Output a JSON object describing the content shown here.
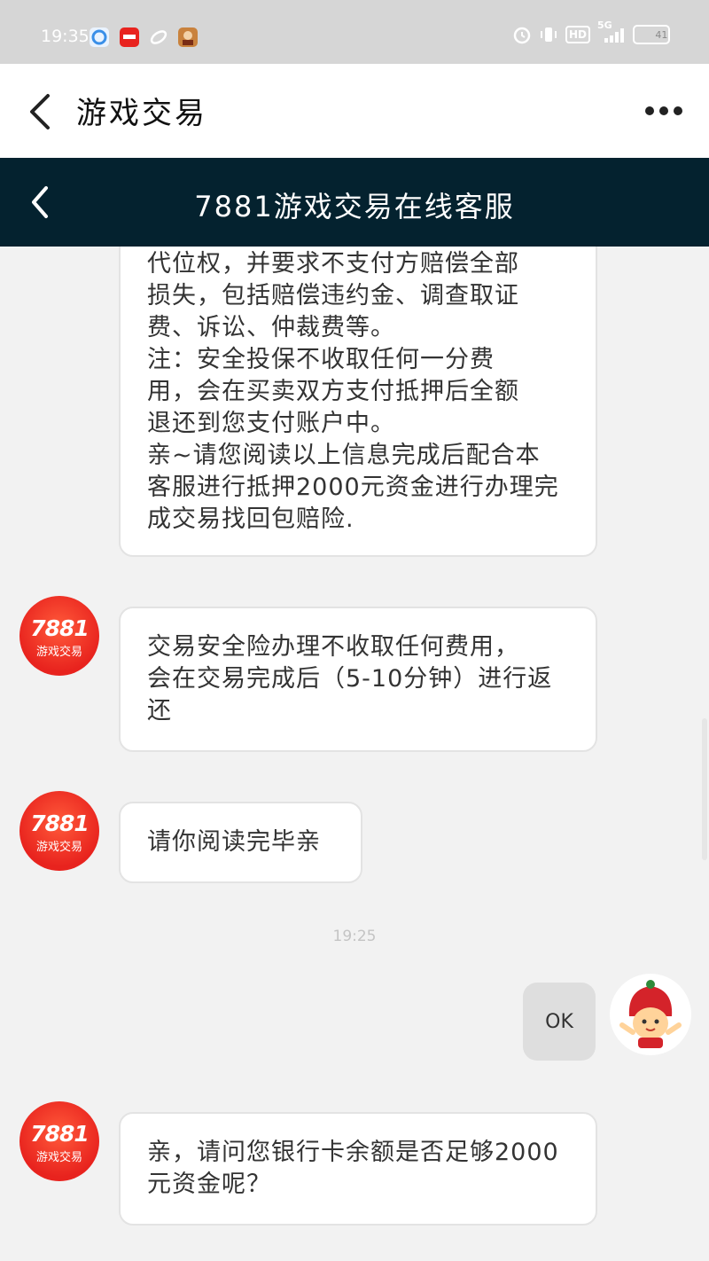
{
  "status_bar": {
    "time": "19:35",
    "hd_label": "HD",
    "network_label": "5G",
    "battery_level": "41",
    "icons": [
      "browser-app-icon",
      "7881-app-icon",
      "link-app-icon",
      "game-app-icon",
      "alarm-icon",
      "vibrate-icon",
      "signal-icon",
      "battery-icon"
    ]
  },
  "app_bar": {
    "title": "游戏交易"
  },
  "chat_header": {
    "title": "7881游戏交易在线客服"
  },
  "avatar": {
    "brand_number": "7881",
    "brand_sub": "游戏交易"
  },
  "messages": [
    {
      "side": "left",
      "text": "代位权，并要求不支付方赔偿全部\n损失，包括赔偿违约金、调查取证\n费、诉讼、仲裁费等。\n注：安全投保不收取任何一分费\n用，会在买卖双方支付抵押后全额\n退还到您支付账户中。\n亲~请您阅读以上信息完成后配合本\n客服进行抵押2000元资金进行办理完\n成交易找回包赔险."
    },
    {
      "side": "left",
      "text": "交易安全险办理不收取任何费用，\n会在交易完成后（5-10分钟）进行返\n还"
    },
    {
      "side": "left",
      "text": "请你阅读完毕亲"
    },
    {
      "side": "right",
      "text": "OK"
    },
    {
      "side": "left",
      "text": "亲，请问您银行卡余额是否足够2000\n元资金呢？"
    }
  ],
  "timestamp": "19:25",
  "colors": {
    "chat_header_bg": "#04222f",
    "brand_red": "#e8231e",
    "chat_bg": "#f2f2f2"
  }
}
